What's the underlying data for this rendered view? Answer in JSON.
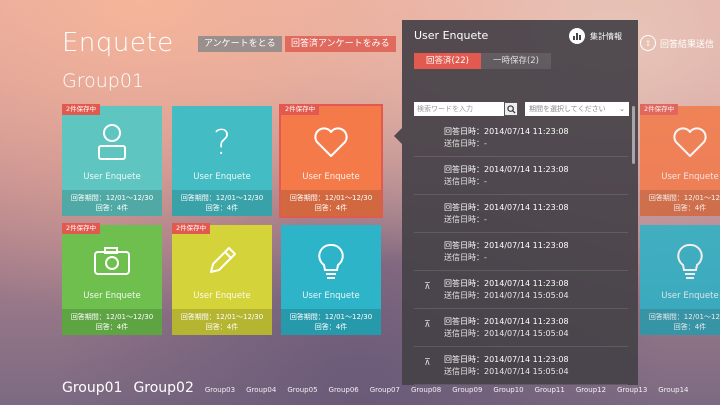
{
  "header": {
    "app_title": "Enquete",
    "survey_button": "アンケートをとる",
    "answered_button": "回答済アンケートをみる",
    "send_results": "回答結果送信"
  },
  "group_title": "Group01",
  "tiles": [
    {
      "badge": "2件保存中",
      "icon": "person-icon",
      "name": "User Enquete",
      "period": "回答期間：12/01～12/30",
      "count": "回答：4件",
      "color": "#5fc5c0"
    },
    {
      "badge": "",
      "icon": "question-icon",
      "name": "User Enquete",
      "period": "回答期間：12/01～12/30",
      "count": "回答：4件",
      "color": "#43bcc4"
    },
    {
      "badge": "2件保存中",
      "icon": "heart-icon",
      "name": "User Enquete",
      "period": "回答期間：12/01～12/30",
      "count": "回答：4件",
      "color": "#f47a4a"
    },
    {
      "badge": "2件保存中",
      "icon": "camera-icon",
      "name": "User Enquete",
      "period": "回答期間：12/01～12/30",
      "count": "回答：4件",
      "color": "#6ebf4e"
    },
    {
      "badge": "2件保存中",
      "icon": "pencil-icon",
      "name": "User Enquete",
      "period": "回答期間：12/01～12/30",
      "count": "回答：4件",
      "color": "#d4d33a"
    },
    {
      "badge": "",
      "icon": "bulb-icon",
      "name": "User Enquete",
      "period": "回答期間：12/01～12/30",
      "count": "回答：4件",
      "color": "#2db4c8"
    },
    {
      "badge": "2件保存中",
      "icon": "heart-icon",
      "name": "User Enquete",
      "period": "回答期間：12/01～12/30",
      "count": "回答：4件",
      "color": "#f47a4a"
    },
    {
      "badge": "",
      "icon": "bulb-icon",
      "name": "User Enquete",
      "period": "回答期間：12/01～12/30",
      "count": "回答：4件",
      "color": "#2db4c8"
    }
  ],
  "panel": {
    "title": "User Enquete",
    "summary_label": "集計情報",
    "tab_answered": "回答済(22)",
    "tab_saved": "一時保存(2)",
    "search_placeholder": "検索ワードを入力",
    "period_placeholder": "期間を選択してください",
    "records": [
      {
        "line1": "回答日時：2014/07/14 11:23:08",
        "line2": "送信日時：-",
        "pinned": false
      },
      {
        "line1": "回答日時：2014/07/14 11:23:08",
        "line2": "送信日時：-",
        "pinned": false
      },
      {
        "line1": "回答日時：2014/07/14 11:23:08",
        "line2": "送信日時：-",
        "pinned": false
      },
      {
        "line1": "回答日時：2014/07/14 11:23:08",
        "line2": "送信日時：-",
        "pinned": false
      },
      {
        "line1": "回答日時：2014/07/14 11:23:08",
        "line2": "送信日時：2014/07/14 15:05:04",
        "pinned": true
      },
      {
        "line1": "回答日時：2014/07/14 11:23:08",
        "line2": "送信日時：2014/07/14 15:05:04",
        "pinned": true
      },
      {
        "line1": "回答日時：2014/07/14 11:23:08",
        "line2": "送信日時：2014/07/14 15:05:04",
        "pinned": true
      }
    ]
  },
  "bottom_nav": [
    "Group01",
    "Group02",
    "Group03",
    "Group04",
    "Group05",
    "Group06",
    "Group07",
    "Group08",
    "Group09",
    "Group10",
    "Group11",
    "Group12",
    "Group13",
    "Group14"
  ]
}
